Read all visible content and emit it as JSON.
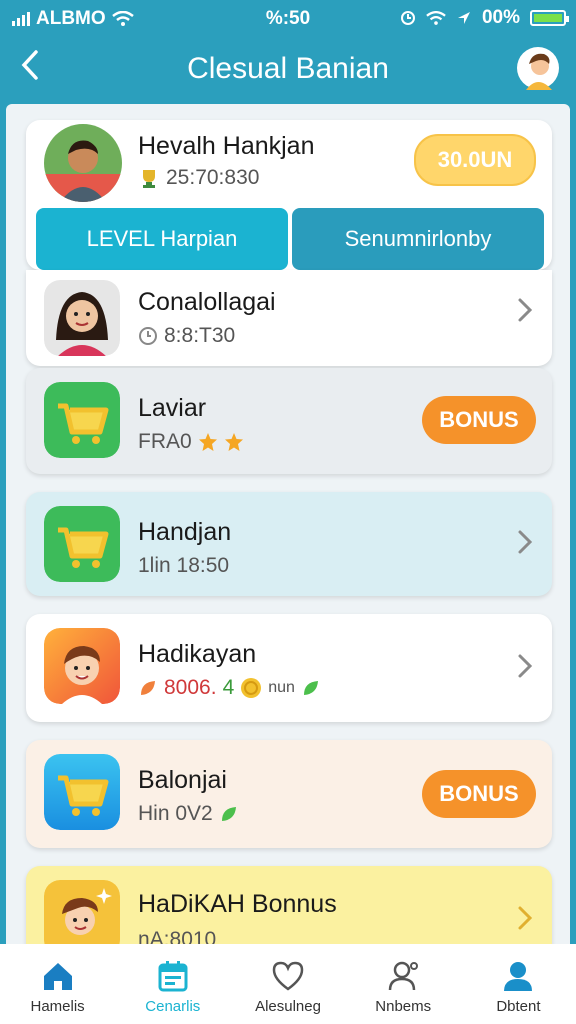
{
  "status": {
    "carrier": "ALBMO",
    "time": "%:50",
    "battery": "00%"
  },
  "header": {
    "title": "Clesual Banian"
  },
  "profile": {
    "name": "Hevalh Hankjan",
    "sub": "25:70:830",
    "price": "30.0UN"
  },
  "tabs": [
    {
      "label": "LEVEL Harpian"
    },
    {
      "label": "Senumnirlonby"
    }
  ],
  "items": [
    {
      "name": "Conalollagai",
      "sub": "8:8:T30"
    },
    {
      "name": "Laviar",
      "sub": "FRA0",
      "badge": "BONUS"
    },
    {
      "name": "Handjan",
      "sub": "1lin 18:50"
    },
    {
      "name": "Hadikayan",
      "sub": "8006.",
      "sub2": "4",
      "sub3": "nun"
    },
    {
      "name": "Balonjai",
      "sub": "Hin 0V2",
      "badge": "BONUS"
    },
    {
      "name": "HaDiKAH Bonnus",
      "sub": "nA:8010"
    }
  ],
  "tabbar": [
    {
      "label": "Hamelis"
    },
    {
      "label": "Cenarlis"
    },
    {
      "label": "Alesulneg"
    },
    {
      "label": "Nnbems"
    },
    {
      "label": "Dbtent"
    }
  ],
  "colors": {
    "header": "#2b9fbd",
    "accent": "#1bb3d1",
    "bonus": "#f5922a",
    "price": "#ffd66b"
  }
}
